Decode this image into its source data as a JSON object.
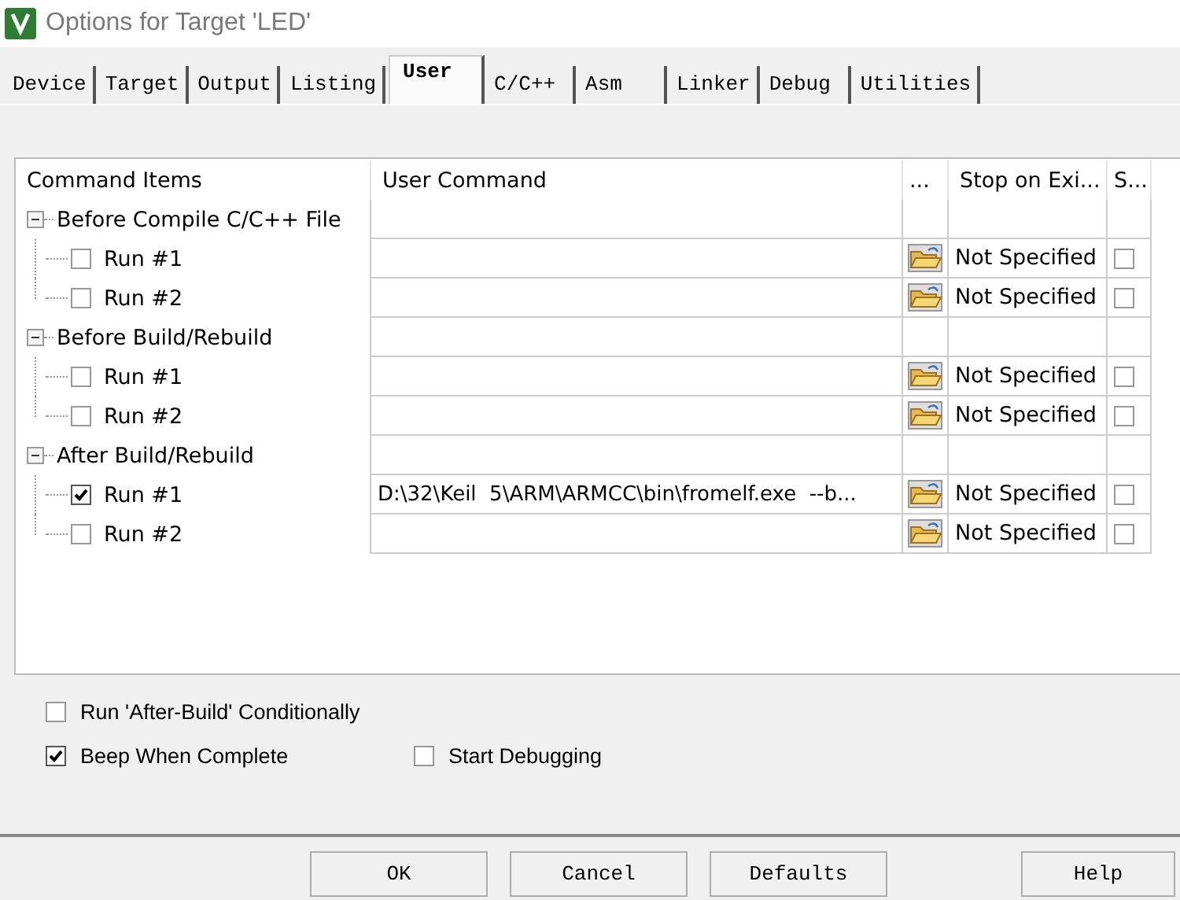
{
  "window": {
    "title": "Options for Target 'LED'"
  },
  "tabs": [
    {
      "label": "Device",
      "selected": false
    },
    {
      "label": "Target",
      "selected": false
    },
    {
      "label": "Output",
      "selected": false
    },
    {
      "label": "Listing",
      "selected": false
    },
    {
      "label": "User",
      "selected": true
    },
    {
      "label": "C/C++",
      "selected": false
    },
    {
      "label": "Asm",
      "selected": false
    },
    {
      "label": "Linker",
      "selected": false
    },
    {
      "label": "Debug",
      "selected": false
    },
    {
      "label": "Utilities",
      "selected": false
    }
  ],
  "command_grid": {
    "columns": [
      "Command Items",
      "User Command",
      "...",
      "Stop on Exi...",
      "S..."
    ],
    "groups": [
      {
        "label": "Before Compile C/C++ File",
        "expanded": true,
        "children": [
          {
            "label": "Run #1",
            "checked": false,
            "stop_on_exit": "Not Specified",
            "column_5_checked": false
          },
          {
            "label": "Run #2",
            "checked": false,
            "stop_on_exit": "Not Specified",
            "column_5_checked": false
          }
        ]
      },
      {
        "label": "Before Build/Rebuild",
        "expanded": true,
        "children": [
          {
            "label": "Run #1",
            "checked": false,
            "stop_on_exit": "Not Specified",
            "column_5_checked": false
          },
          {
            "label": "Run #2",
            "checked": false,
            "stop_on_exit": "Not Specified",
            "column_5_checked": false
          }
        ]
      },
      {
        "label": "After Build/Rebuild",
        "expanded": true,
        "children": [
          {
            "label": "Run #1",
            "checked": true,
            "command": "D:\\32\\Keil  5\\ARM\\ARMCC\\bin\\fromelf.exe  --b...",
            "stop_on_exit": "Not Specified",
            "column_5_checked": false
          },
          {
            "label": "Run #2",
            "checked": false,
            "stop_on_exit": "Not Specified",
            "column_5_checked": false
          }
        ]
      }
    ]
  },
  "options": [
    [
      {
        "label": "Run 'After-Build' Conditionally",
        "checked": false
      }
    ],
    [
      {
        "label": "Beep When Complete",
        "checked": true
      },
      {
        "label": "Start Debugging",
        "checked": false
      }
    ]
  ],
  "buttons": [
    "OK",
    "Cancel",
    "Defaults",
    "Help"
  ]
}
